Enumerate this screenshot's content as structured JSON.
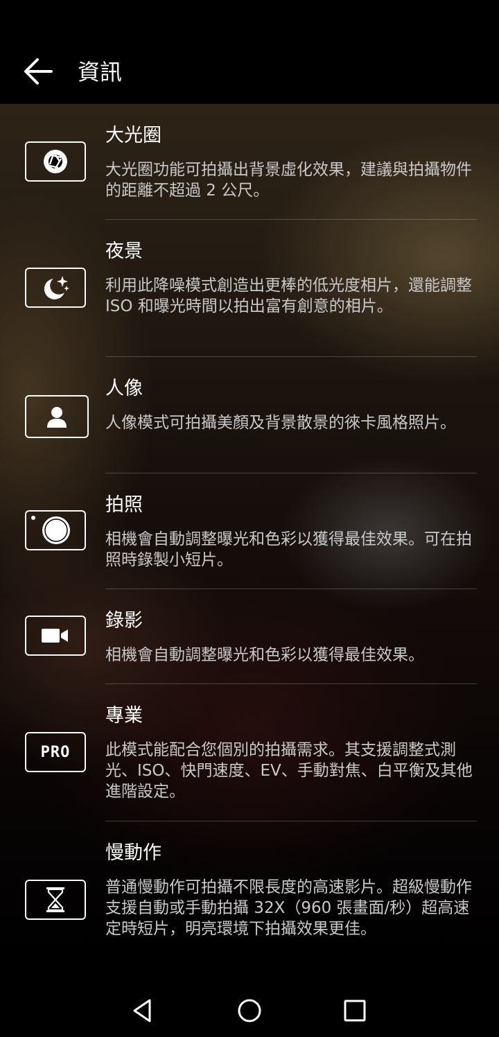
{
  "header": {
    "title": "資訊",
    "back_icon": "arrow-left-icon"
  },
  "items": [
    {
      "title": "大光圈",
      "description": "大光圈功能可拍攝出背景虛化效果，建議與拍攝物件的距離不超過 2 公尺。",
      "icon": "aperture-icon"
    },
    {
      "title": "夜景",
      "description": "利用此降噪模式創造出更棒的低光度相片，還能調整 ISO 和曝光時間以拍出富有創意的相片。",
      "icon": "moon-stars-icon"
    },
    {
      "title": "人像",
      "description": "人像模式可拍攝美顏及背景散景的徠卡風格照片。",
      "icon": "person-icon"
    },
    {
      "title": "拍照",
      "description": "相機會自動調整曝光和色彩以獲得最佳效果。可在拍照時錄製小短片。",
      "icon": "camera-shutter-icon"
    },
    {
      "title": "錄影",
      "description": "相機會自動調整曝光和色彩以獲得最佳效果。",
      "icon": "video-camera-icon"
    },
    {
      "title": "專業",
      "description": "此模式能配合您個別的拍攝需求。其支援調整式測光、ISO、快門速度、EV、手動對焦、白平衡及其他進階設定。",
      "icon": "pro-icon",
      "icon_text": "PRO"
    },
    {
      "title": "慢動作",
      "description": "普通慢動作可拍攝不限長度的高速影片。超級慢動作支援自動或手動拍攝 32X（960 張畫面/秒）超高速定時短片，明亮環境下拍攝效果更佳。",
      "icon": "hourglass-icon"
    }
  ],
  "navbar": {
    "back": "triangle-back-icon",
    "home": "circle-home-icon",
    "recents": "square-recents-icon"
  }
}
